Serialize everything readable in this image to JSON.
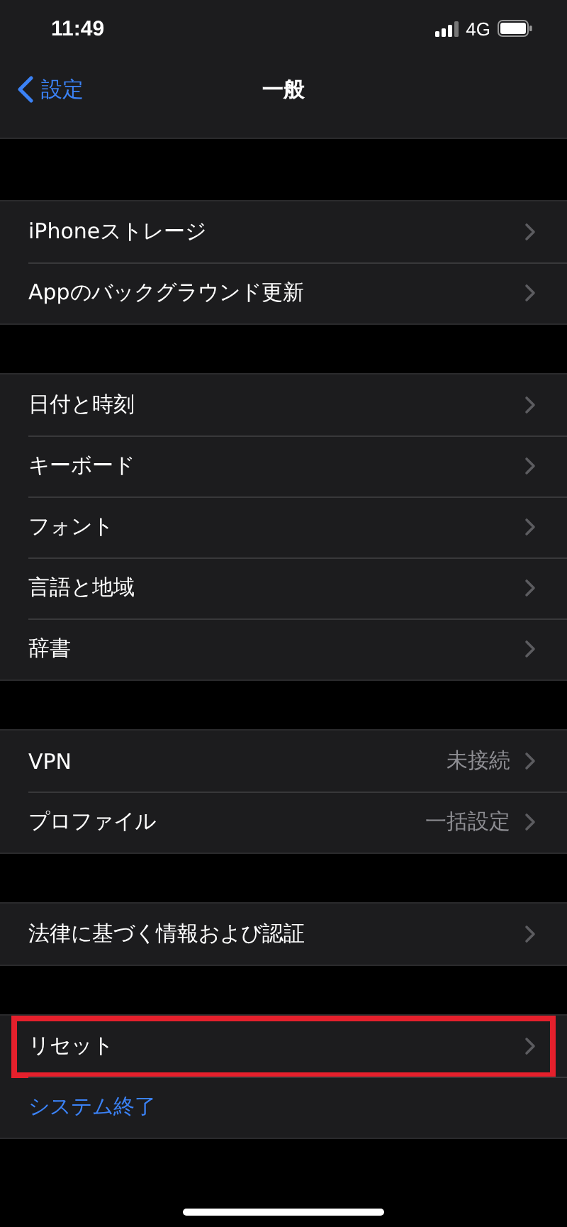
{
  "status_bar": {
    "time": "11:49",
    "network": "4G"
  },
  "nav_bar": {
    "back": "設定",
    "title": "一般"
  },
  "sections": [
    {
      "rows": [
        {
          "kind": "link",
          "label": "iPhoneストレージ",
          "highlighted": false
        },
        {
          "kind": "link",
          "label": "Appのバックグラウンド更新",
          "highlighted": false
        }
      ]
    },
    {
      "rows": [
        {
          "kind": "link",
          "label": "日付と時刻",
          "highlighted": false
        },
        {
          "kind": "link",
          "label": "キーボード",
          "highlighted": false
        },
        {
          "kind": "link",
          "label": "フォント",
          "highlighted": false
        },
        {
          "kind": "link",
          "label": "言語と地域",
          "highlighted": false
        },
        {
          "kind": "link",
          "label": "辞書",
          "highlighted": false
        }
      ]
    },
    {
      "rows": [
        {
          "kind": "detail",
          "label": "VPN",
          "value": "未接続",
          "highlighted": false
        },
        {
          "kind": "detail",
          "label": "プロファイル",
          "value": "一括設定",
          "highlighted": false
        }
      ]
    },
    {
      "rows": [
        {
          "kind": "link",
          "label": "法律に基づく情報および認証",
          "highlighted": false
        }
      ]
    },
    {
      "rows": [
        {
          "kind": "link",
          "label": "リセット",
          "highlighted": true
        },
        {
          "kind": "action",
          "label": "システム終了",
          "highlighted": false
        }
      ]
    }
  ]
}
